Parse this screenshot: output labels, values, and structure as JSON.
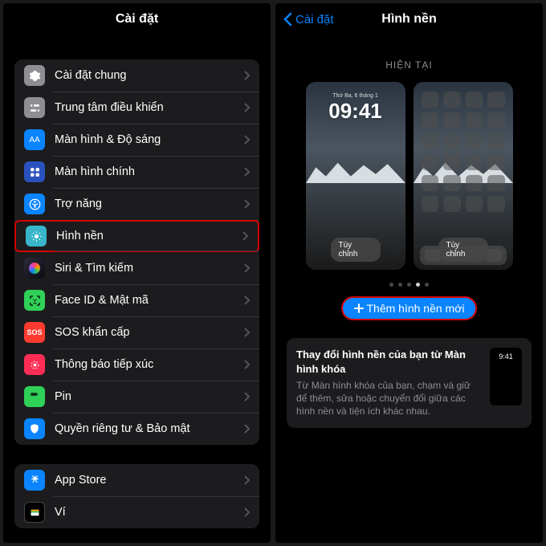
{
  "left": {
    "title": "Cài đặt",
    "group1": [
      {
        "label": "Cài đặt chung"
      },
      {
        "label": "Trung tâm điều khiển"
      },
      {
        "label": "Màn hình & Độ sáng"
      },
      {
        "label": "Màn hình chính"
      },
      {
        "label": "Trợ năng"
      },
      {
        "label": "Hình nền"
      },
      {
        "label": "Siri & Tìm kiếm"
      },
      {
        "label": "Face ID & Mật mã"
      },
      {
        "label": "SOS khẩn cấp"
      },
      {
        "label": "Thông báo tiếp xúc"
      },
      {
        "label": "Pin"
      },
      {
        "label": "Quyền riêng tư & Bảo mật"
      }
    ],
    "group2": [
      {
        "label": "App Store"
      },
      {
        "label": "Ví"
      }
    ],
    "icon_glyphs": {
      "display": "AA",
      "sos": "SOS"
    }
  },
  "right": {
    "back": "Cài đặt",
    "title": "Hình nền",
    "current_header": "HIỆN TẠI",
    "lock_date": "Thứ Ba, 6 tháng 1",
    "lock_time": "09:41",
    "customize": "Tùy chỉnh",
    "add_button": "Thêm hình nền mới",
    "card_title": "Thay đổi hình nền của bạn từ Màn hình khóa",
    "card_desc": "Từ Màn hình khóa của bạn, chạm và giữ để thêm, sửa hoặc chuyển đổi giữa các hình nền và tiện ích khác nhau.",
    "card_time": "9:41"
  }
}
